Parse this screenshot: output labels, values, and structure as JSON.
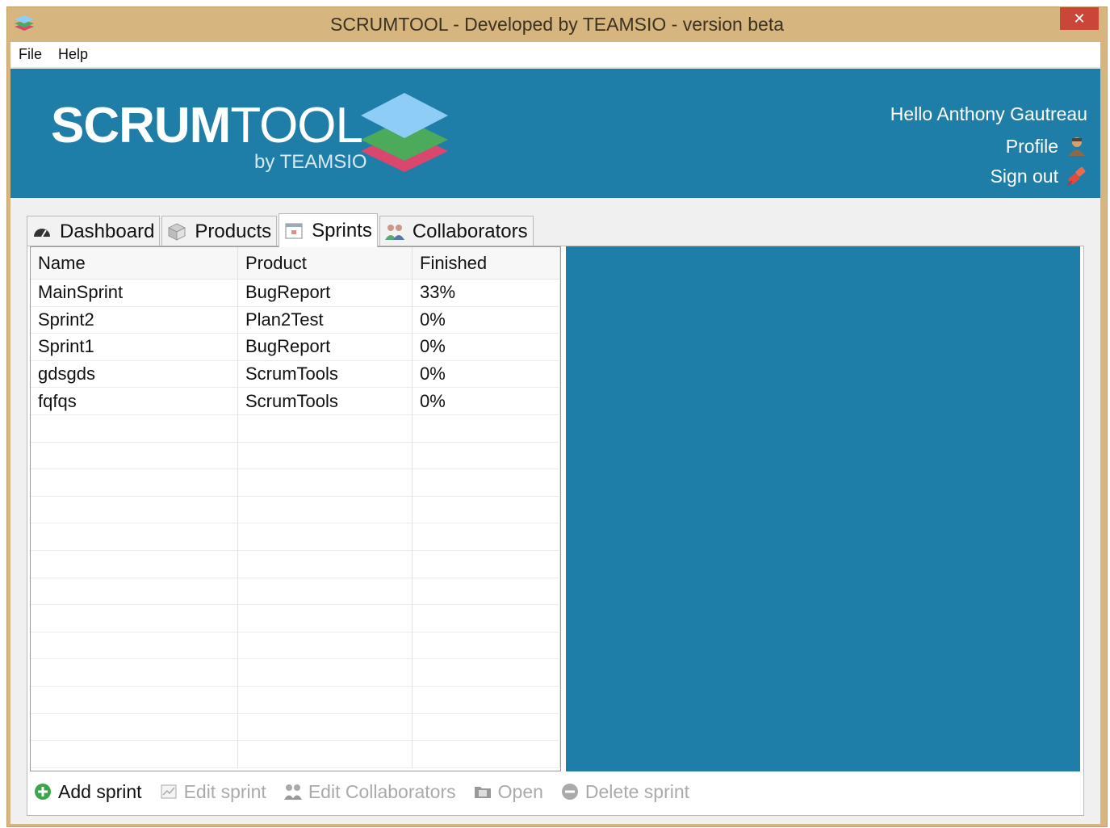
{
  "window": {
    "title": "SCRUMTOOL - Developed by TEAMSIO - version beta",
    "close_label": "✕"
  },
  "menu": {
    "items": [
      "File",
      "Help"
    ]
  },
  "banner": {
    "logo_bold": "SCRUM",
    "logo_light": "TOOL",
    "logo_by": "by TEAMSIO",
    "colors": {
      "background": "#1f7ea8",
      "stack_top": "#8ecdf5",
      "stack_mid": "#4caa5b",
      "stack_bottom": "#d9466e"
    }
  },
  "user": {
    "greeting": "Hello Anthony Gautreau",
    "profile_label": "Profile",
    "signout_label": "Sign out"
  },
  "tabs": [
    {
      "label": "Dashboard",
      "icon": "gauge-icon",
      "active": false
    },
    {
      "label": "Products",
      "icon": "box-icon",
      "active": false
    },
    {
      "label": "Sprints",
      "icon": "calendar-icon",
      "active": true
    },
    {
      "label": "Collaborators",
      "icon": "group-icon",
      "active": false
    }
  ],
  "sprints_table": {
    "columns": [
      "Name",
      "Product",
      "Finished"
    ],
    "rows": [
      [
        "MainSprint",
        "BugReport",
        "33%"
      ],
      [
        "Sprint2",
        "Plan2Test",
        "0%"
      ],
      [
        "Sprint1",
        "BugReport",
        "0%"
      ],
      [
        "gdsgds",
        "ScrumTools",
        "0%"
      ],
      [
        "fqfqs",
        "ScrumTools",
        "0%"
      ]
    ]
  },
  "toolbar": {
    "add_sprint": "Add sprint",
    "edit_sprint": "Edit sprint",
    "edit_collaborators": "Edit Collaborators",
    "open": "Open",
    "delete_sprint": "Delete sprint"
  }
}
